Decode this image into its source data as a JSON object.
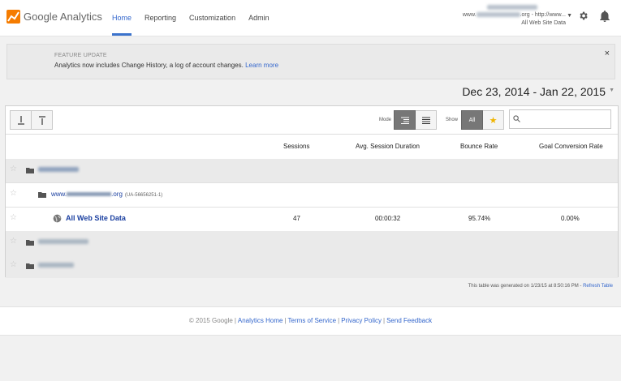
{
  "brand": {
    "logo_text": "Google Analytics",
    "accent": "#3366cc",
    "logo_color": "#f57c00"
  },
  "nav": {
    "items": [
      {
        "label": "Home"
      },
      {
        "label": "Reporting"
      },
      {
        "label": "Customization"
      },
      {
        "label": "Admin"
      }
    ]
  },
  "account": {
    "url_prefix": "www.",
    "url_suffix": ".org - http://www...",
    "view": "All Web Site Data"
  },
  "banner": {
    "title": "FEATURE UPDATE",
    "text": "Analytics now includes Change History, a log of account changes.",
    "link": "Learn more"
  },
  "daterange": "Dec 23, 2014 - Jan 22, 2015",
  "toolbar": {
    "mode_label": "Mode",
    "show_label": "Show",
    "show_all": "All",
    "search_placeholder": ""
  },
  "table": {
    "columns": [
      "Sessions",
      "Avg. Session Duration",
      "Bounce Rate",
      "Goal Conversion Rate"
    ],
    "property_prefix": "www.",
    "property_suffix": ".org",
    "property_id": "(UA-56656251-1)",
    "view_row": {
      "name": "All Web Site Data",
      "sessions": "47",
      "avg_duration": "00:00:32",
      "bounce_rate": "95.74%",
      "goal_conversion": "0.00%"
    }
  },
  "generated": {
    "text": "This table was generated on 1/23/15 at 8:50:16 PM -",
    "link": "Refresh Table"
  },
  "footer": {
    "copyright": "© 2015 Google",
    "links": [
      "Analytics Home",
      "Terms of Service",
      "Privacy Policy",
      "Send Feedback"
    ]
  }
}
